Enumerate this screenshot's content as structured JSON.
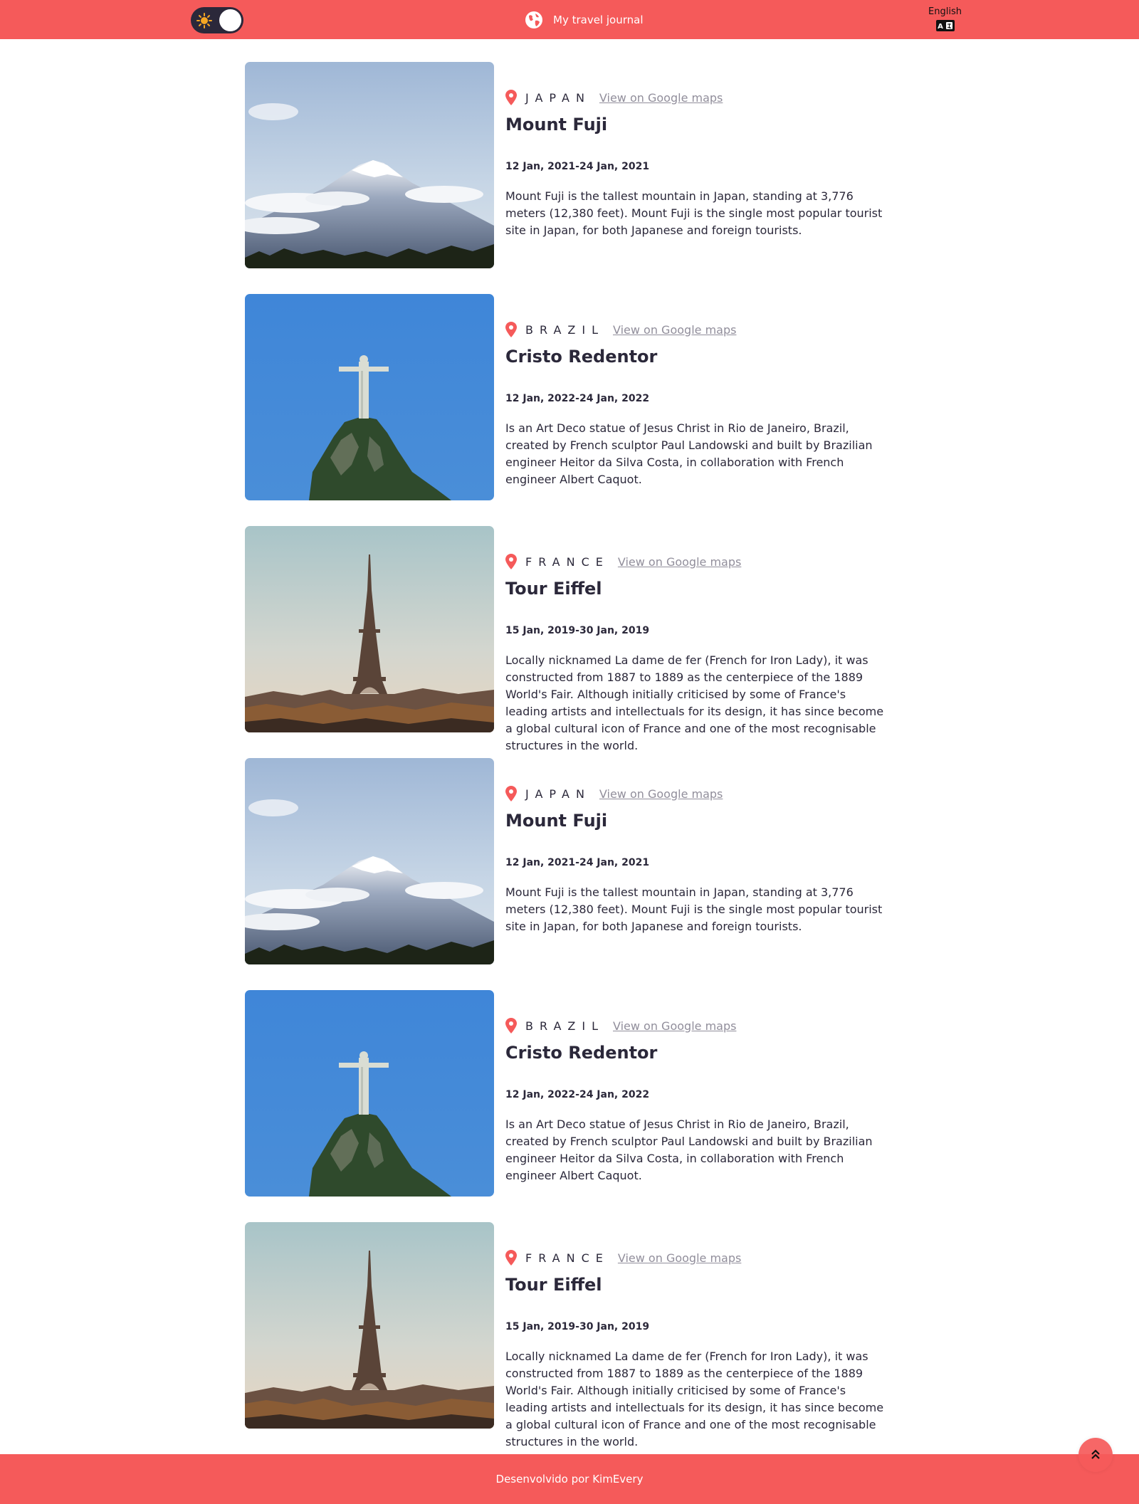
{
  "header": {
    "title": "My travel journal",
    "language": "English",
    "theme_toggle_icon": "sun-icon",
    "brand_icon": "globe-icon",
    "language_icon": "translate-icon"
  },
  "entries": [
    {
      "country": "JAPAN",
      "maps_link": "View on Google maps",
      "title": "Mount Fuji",
      "dates": "12 Jan, 2021-24 Jan, 2021",
      "description": "Mount Fuji is the tallest mountain in Japan, standing at 3,776 meters (12,380 feet). Mount Fuji is the single most popular tourist site in Japan, for both Japanese and foreign tourists."
    },
    {
      "country": "BRAZIL",
      "maps_link": "View on Google maps",
      "title": "Cristo Redentor",
      "dates": "12 Jan, 2022-24 Jan, 2022",
      "description": "Is an Art Deco statue of Jesus Christ in Rio de Janeiro, Brazil, created by French sculptor Paul Landowski and built by Brazilian engineer Heitor da Silva Costa, in collaboration with French engineer Albert Caquot."
    },
    {
      "country": "FRANCE",
      "maps_link": "View on Google maps",
      "title": "Tour Eiffel",
      "dates": "15 Jan, 2019-30 Jan, 2019",
      "description": "Locally nicknamed La dame de fer (French for Iron Lady), it was constructed from 1887 to 1889 as the centerpiece of the 1889 World's Fair. Although initially criticised by some of France's leading artists and intellectuals for its design, it has since become a global cultural icon of France and one of the most recognisable structures in the world."
    },
    {
      "country": "JAPAN",
      "maps_link": "View on Google maps",
      "title": "Mount Fuji",
      "dates": "12 Jan, 2021-24 Jan, 2021",
      "description": "Mount Fuji is the tallest mountain in Japan, standing at 3,776 meters (12,380 feet). Mount Fuji is the single most popular tourist site in Japan, for both Japanese and foreign tourists."
    },
    {
      "country": "BRAZIL",
      "maps_link": "View on Google maps",
      "title": "Cristo Redentor",
      "dates": "12 Jan, 2022-24 Jan, 2022",
      "description": "Is an Art Deco statue of Jesus Christ in Rio de Janeiro, Brazil, created by French sculptor Paul Landowski and built by Brazilian engineer Heitor da Silva Costa, in collaboration with French engineer Albert Caquot."
    },
    {
      "country": "FRANCE",
      "maps_link": "View on Google maps",
      "title": "Tour Eiffel",
      "dates": "15 Jan, 2019-30 Jan, 2019",
      "description": "Locally nicknamed La dame de fer (French for Iron Lady), it was constructed from 1887 to 1889 as the centerpiece of the 1889 World's Fair. Although initially criticised by some of France's leading artists and intellectuals for its design, it has since become a global cultural icon of France and one of the most recognisable structures in the world."
    }
  ],
  "footer": {
    "credit": "Desenvolvido por KimEvery",
    "back_to_top_icon": "chevrons-up-icon"
  },
  "colors": {
    "accent": "#f55a5a",
    "text_dark": "#2b283a",
    "text_muted": "#918e9b"
  }
}
